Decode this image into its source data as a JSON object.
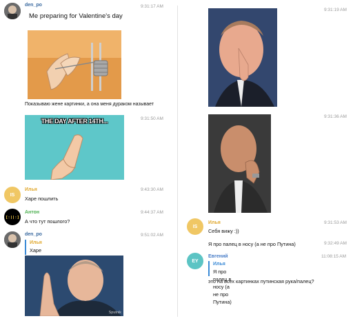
{
  "left": {
    "m1": {
      "author": "den_po",
      "time": "9:31:17 AM",
      "img_text": "Me preparing for Valentine's day",
      "caption": "Показываю жене картинки, а она меня дураком называет"
    },
    "m2": {
      "time": "9:31:50 AM",
      "img_text": "THE DAY AFTER 14TH..."
    },
    "m3": {
      "author": "Илья",
      "initials": "IS",
      "time": "9:43:30 AM",
      "text": "Харе пошлить"
    },
    "m4": {
      "author": "Антон",
      "avatar_text": "[:||:]",
      "time": "9:44:37 AM",
      "text": "А что тут пошлого?"
    },
    "m5": {
      "author": "den_po",
      "time": "9:51:02 AM",
      "quote_author": "Илья",
      "quote_text": "Харе пошлить",
      "watermark": "Sputnik"
    }
  },
  "right": {
    "r1": {
      "time": "9:31:19 AM"
    },
    "r2": {
      "time": "9:31:36 AM"
    },
    "r3": {
      "author": "Илья",
      "initials": "IS",
      "time": "9:31:53 AM",
      "text1": "Себя вижу :))",
      "text2": "Я про палец в носу (а не про Путина)",
      "time2": "9:32:49 AM"
    },
    "r4": {
      "author": "Евгений",
      "initials": "EY",
      "time": "11:08:15 AM",
      "quote_author": "Илья",
      "quote_text": "Я про палец в носу (а не про Путина)",
      "text": "это на всех картинках путинская рука/палец?"
    }
  },
  "colors": {
    "den_po": "#3b6aa0",
    "ilya": "#e0a82e",
    "anton": "#4caf50",
    "evgeny": "#4a7ec8",
    "quote_bar": "#3a8ad6",
    "avatar_is": "#f0c764",
    "avatar_ey": "#5cc4c4"
  }
}
